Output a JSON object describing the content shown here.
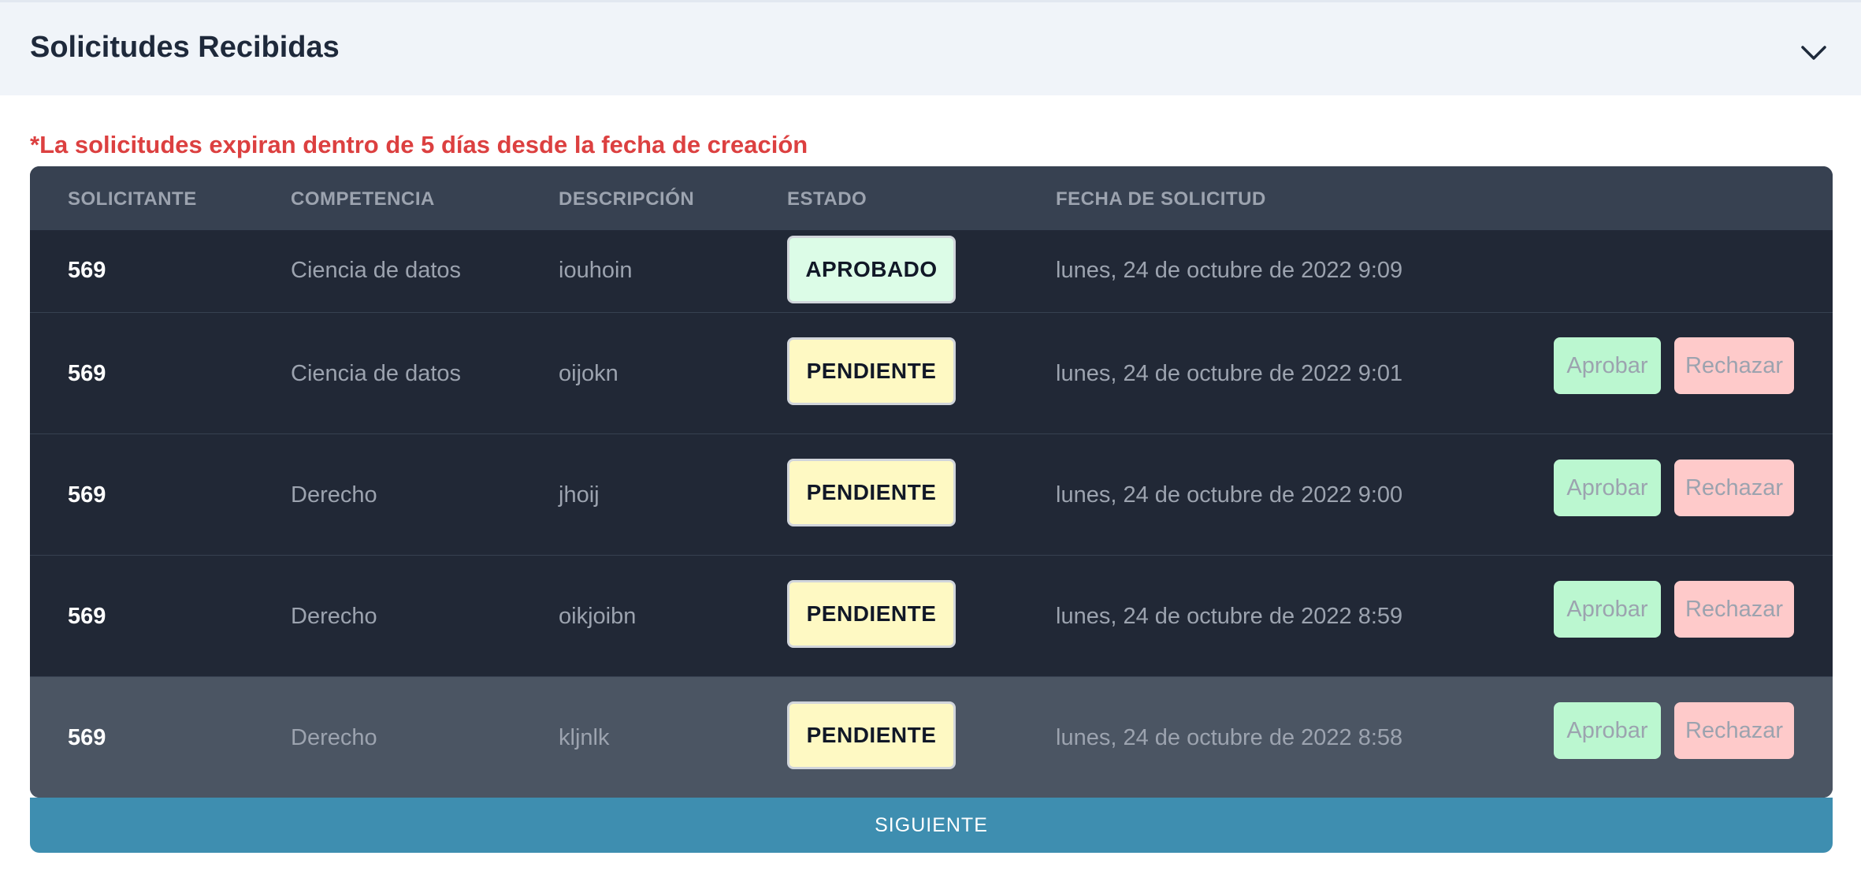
{
  "section": {
    "title": "Solicitudes Recibidas",
    "notice": "*La solicitudes expiran dentro de 5 días desde la fecha de creación",
    "notice_color": "#dc4040"
  },
  "table": {
    "headers": [
      "SOLICITANTE",
      "COMPETENCIA",
      "DESCRIPCIÓN",
      "ESTADO",
      "FECHA DE SOLICITUD"
    ],
    "rows": [
      {
        "solicitante": "569",
        "competencia": "Ciencia de datos",
        "descripcion": "iouhoin",
        "estado": "APROBADO",
        "fecha": "lunes, 24 de octubre de 2022 9:09"
      },
      {
        "solicitante": "569",
        "competencia": "Ciencia de datos",
        "descripcion": "oijokn",
        "estado": "PENDIENTE",
        "fecha": "lunes, 24 de octubre de 2022 9:01",
        "approve_label": "Aprobar",
        "reject_label": "Rechazar"
      },
      {
        "solicitante": "569",
        "competencia": "Derecho",
        "descripcion": "jhoij",
        "estado": "PENDIENTE",
        "fecha": "lunes, 24 de octubre de 2022 9:00",
        "approve_label": "Aprobar",
        "reject_label": "Rechazar"
      },
      {
        "solicitante": "569",
        "competencia": "Derecho",
        "descripcion": "oikjoibn",
        "estado": "PENDIENTE",
        "fecha": "lunes, 24 de octubre de 2022 8:59",
        "approve_label": "Aprobar",
        "reject_label": "Rechazar"
      },
      {
        "solicitante": "569",
        "competencia": "Derecho",
        "descripcion": "kljnlk",
        "estado": "PENDIENTE",
        "fecha": "lunes, 24 de octubre de 2022 8:58",
        "approve_label": "Aprobar",
        "reject_label": "Rechazar"
      }
    ]
  },
  "pagination": {
    "next_label": "SIGUIENTE"
  },
  "colors": {
    "status_approved_bg": "#dcfce7",
    "status_pending_bg": "#fef9c3",
    "approve_button_bg": "#bbf7d0",
    "reject_button_bg": "#fecaca",
    "next_button_bg": "#3e8eb0"
  },
  "icons": {
    "accordion_toggle": "chevron-down-icon"
  }
}
